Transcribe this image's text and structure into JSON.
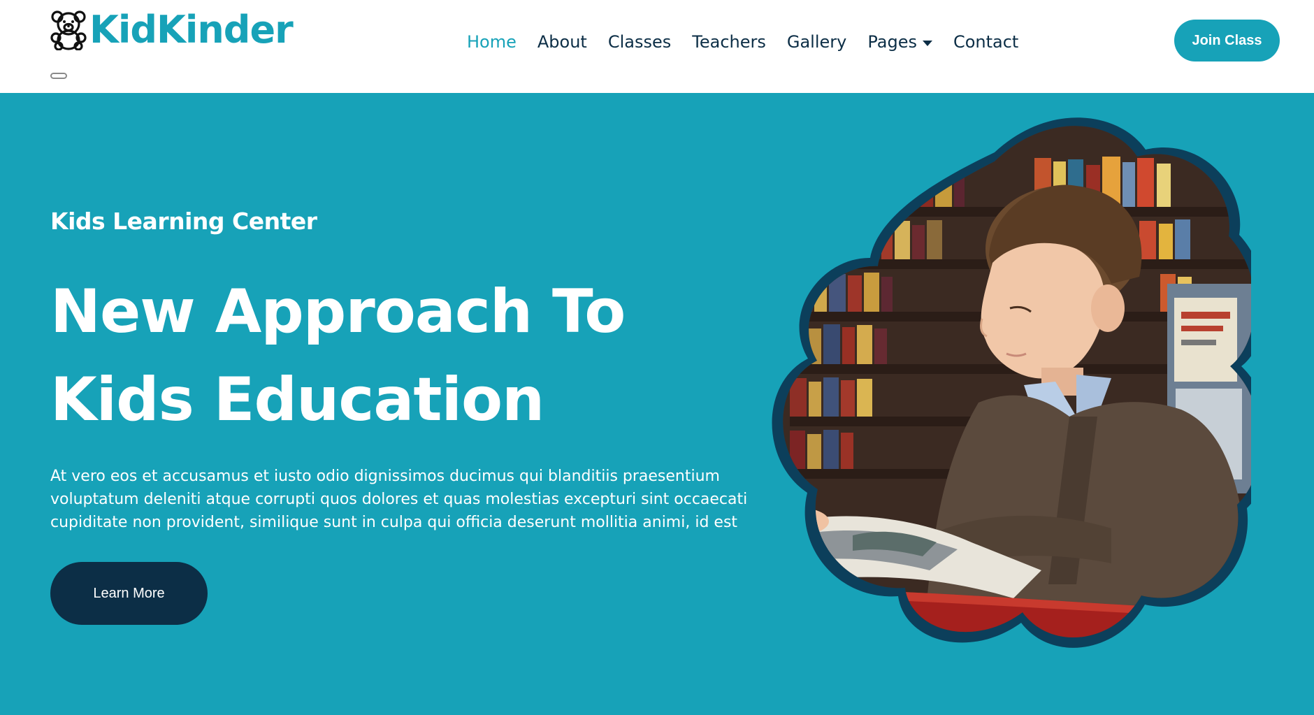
{
  "brand": {
    "name": "KidKinder",
    "icon": "teddy-bear-icon"
  },
  "nav": {
    "items": [
      {
        "label": "Home",
        "active": true
      },
      {
        "label": "About"
      },
      {
        "label": "Classes"
      },
      {
        "label": "Teachers"
      },
      {
        "label": "Gallery"
      },
      {
        "label": "Pages",
        "dropdown": true
      },
      {
        "label": "Contact"
      }
    ],
    "cta_label": "Join Class"
  },
  "hero": {
    "subtitle": "Kids Learning Center",
    "title": "New Approach To Kids Education",
    "description": "At vero eos et accusamus et iusto odio dignissimos ducimus qui blanditiis praesentium voluptatum deleniti atque corrupti quos dolores et quas molestias excepturi sint occaecati cupiditate non provident, similique sunt in culpa qui officia deserunt mollitia animi, id est",
    "button_label": "Learn More",
    "image": "child-reading-in-library"
  },
  "colors": {
    "primary": "#17a2b8",
    "dark": "#0c2e46",
    "white": "#ffffff"
  }
}
